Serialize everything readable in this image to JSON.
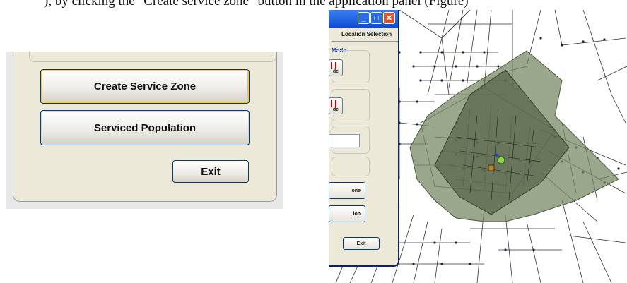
{
  "caption": {
    "text": "), by clicking the \"Create service zone\" button in the application panel (Figure)"
  },
  "left_panel": {
    "buttons": {
      "create_service_zone": "Create Service Zone",
      "serviced_population": "Serviced Population",
      "exit": "Exit"
    }
  },
  "right_window": {
    "title_buttons": {
      "minimize": "_",
      "maximize": "□",
      "close": "✕"
    },
    "tab_label": "Location Selection",
    "section_label": "Mode",
    "small_button_1": "de",
    "small_button_2": "de",
    "textbox_value": "",
    "buttons": {
      "create_zone_partial": "one",
      "population_partial": "ion",
      "exit": "Exit"
    }
  },
  "map": {
    "outer_zone_color": "#7a8a66",
    "inner_zone_color": "#5d6a4d",
    "facility_marker_color": "#8fd14f",
    "candidate_marker_color": "#b8862e",
    "network_node_color": "#2a1a40"
  }
}
